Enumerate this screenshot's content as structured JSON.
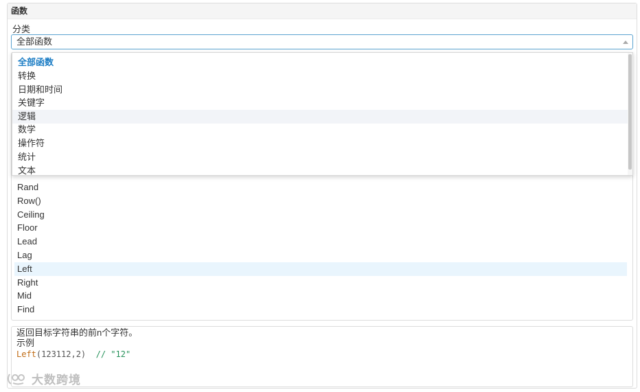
{
  "panel": {
    "title": "函数"
  },
  "category": {
    "label": "分类",
    "selected": "全部函数"
  },
  "dropdown": {
    "options": [
      "全部函数",
      "转换",
      "日期和时间",
      "关键字",
      "逻辑",
      "数学",
      "操作符",
      "统计",
      "文本"
    ],
    "active_index": 0,
    "hover_index": 4
  },
  "functions": {
    "items": [
      "Rand",
      "Row()",
      "Ceiling",
      "Floor",
      "Lead",
      "Lag",
      "Left",
      "Right",
      "Mid",
      "Find"
    ],
    "selected_index": 6
  },
  "description": {
    "text": "返回目标字符串的前n个字符。",
    "example_label": "示例",
    "example_fn": "Left",
    "example_args": "(123112,2)",
    "example_comment": "// \"12\""
  },
  "watermark": {
    "text": "大数跨境"
  },
  "colors": {
    "accent": "#1a7cc4",
    "selected_row": "#e9f5fd",
    "code_fn": "#c06b14",
    "code_comment": "#27925b"
  }
}
